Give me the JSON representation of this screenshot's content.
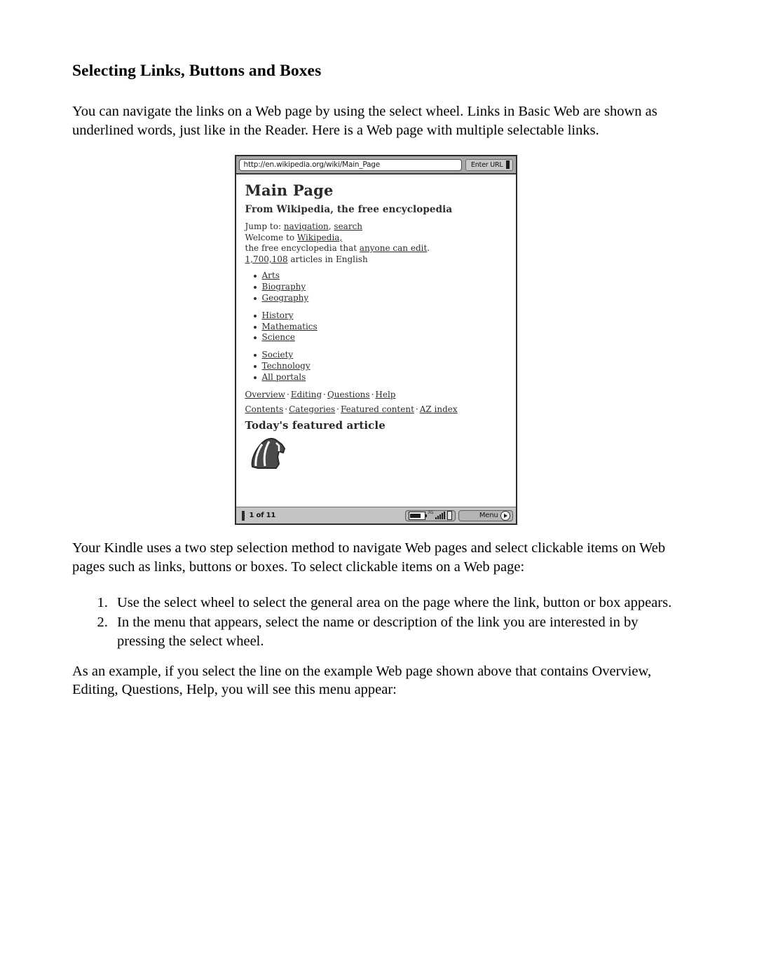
{
  "document": {
    "heading": "Selecting Links, Buttons and Boxes",
    "intro_paragraph": "You can navigate the links on a Web page by using the select wheel. Links in Basic Web are shown as underlined words, just like in the Reader. Here is a Web page with multiple selectable links.",
    "after_figure_paragraph": "Your Kindle uses a two step selection method to navigate Web pages and select clickable items on Web pages such as links, buttons or boxes. To select clickable items on a Web page:",
    "steps": [
      "Use the select wheel to select the general area on the page where the link, button or box appears.",
      "In the menu that appears, select the name or description of the link you are interested in by pressing the select wheel."
    ],
    "closing_paragraph": "As an example, if you select the line on the example Web page shown above that contains Overview, Editing, Questions, Help, you will see this menu appear:"
  },
  "kindle": {
    "toolbar": {
      "url_value": "http://en.wikipedia.org/wiki/Main_Page",
      "enter_url_label": "Enter URL"
    },
    "page": {
      "title": "Main Page",
      "subtitle": "From Wikipedia, the free encyclopedia",
      "jump_prefix": "Jump to: ",
      "jump_links": [
        "navigation",
        "search"
      ],
      "jump_separator": ", ",
      "welcome_prefix": "Welcome to ",
      "welcome_link": "Wikipedia,",
      "tagline_prefix": "the free encyclopedia that ",
      "tagline_link": "anyone can edit",
      "tagline_suffix": ".",
      "article_count_link": "1,700,108",
      "article_count_suffix": " articles in English",
      "portal_groups": [
        [
          "Arts",
          "Biography",
          "Geography"
        ],
        [
          "History",
          "Mathematics",
          "Science"
        ],
        [
          "Society",
          "Technology",
          "All portals"
        ]
      ],
      "nav_line_1": [
        "Overview",
        "Editing",
        "Questions",
        "Help"
      ],
      "nav_line_2": [
        "Contents",
        "Categories",
        "Featured content",
        "AZ index"
      ],
      "nav_separator": "·",
      "featured_heading": "Today's featured article",
      "thumbnail_name": "featured-article-thumbnail"
    },
    "status": {
      "page_position": "1 of 11",
      "signal_label": "3G",
      "menu_label": "Menu"
    }
  }
}
